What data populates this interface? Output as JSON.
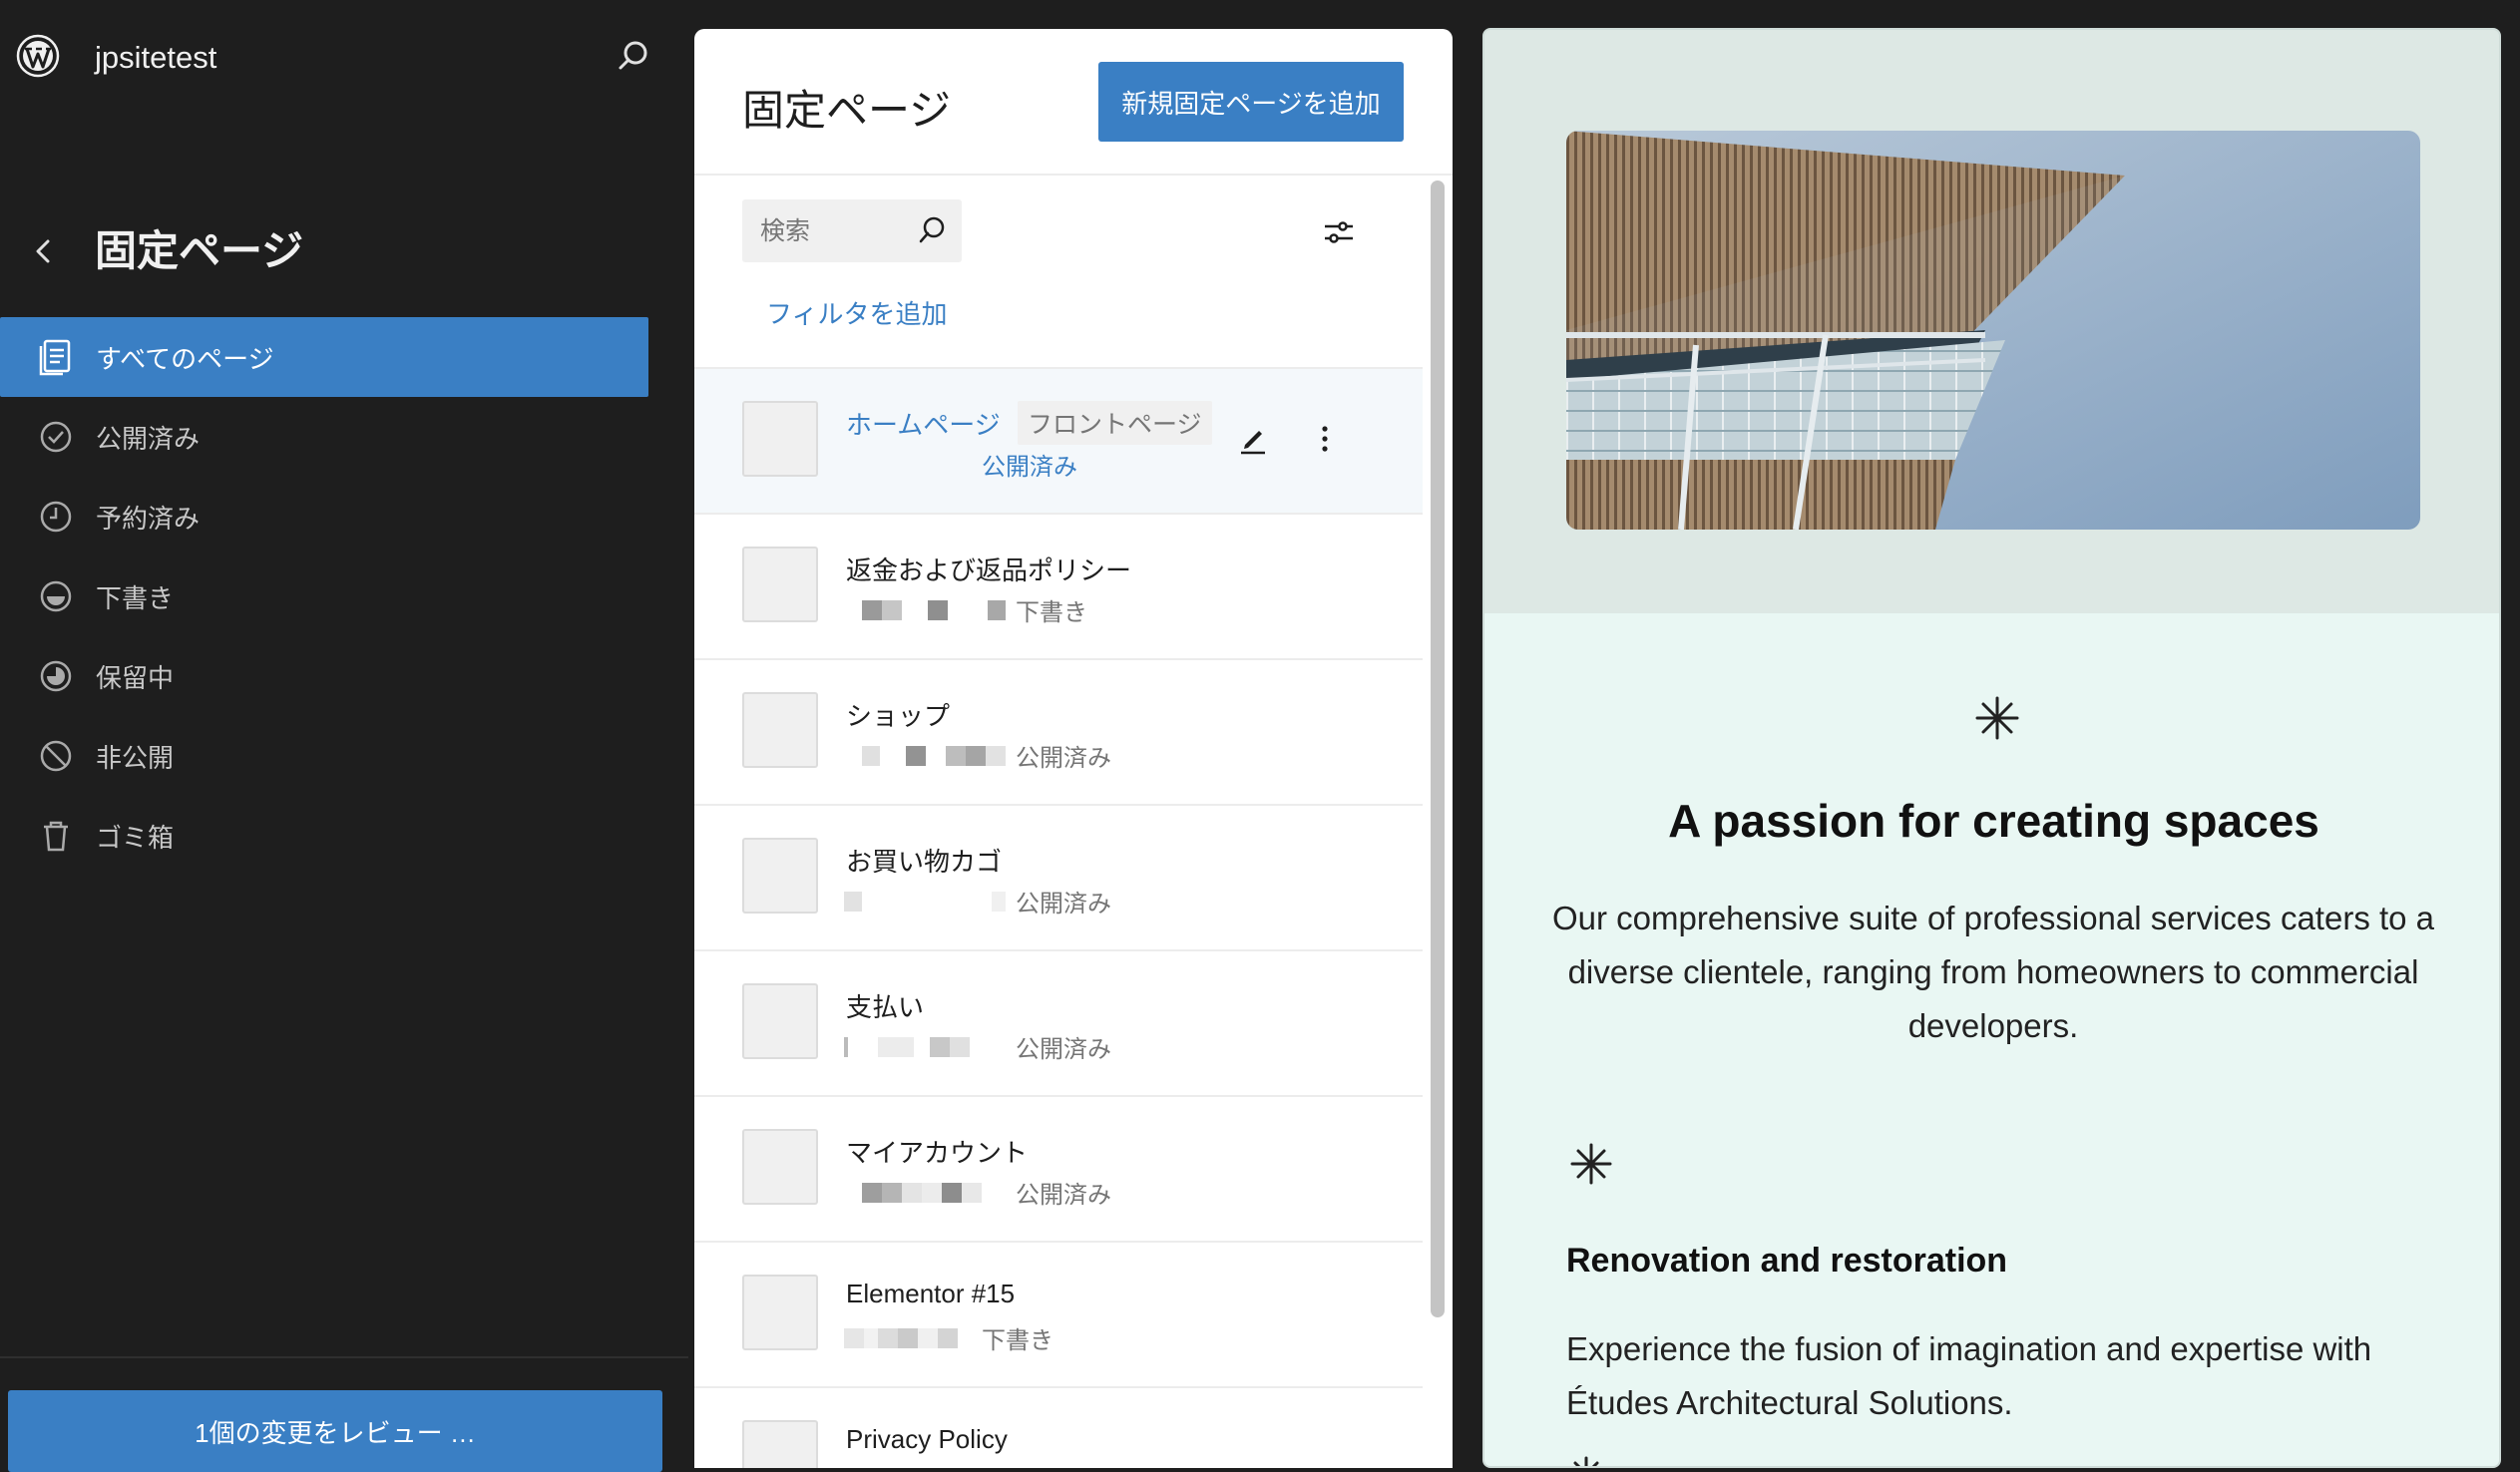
{
  "site": {
    "title": "jpsitetest"
  },
  "sidebar": {
    "heading": "固定ページ",
    "items": [
      {
        "label": "すべてのページ",
        "icon": "pages-icon",
        "active": true
      },
      {
        "label": "公開済み",
        "icon": "published-icon"
      },
      {
        "label": "予約済み",
        "icon": "scheduled-icon"
      },
      {
        "label": "下書き",
        "icon": "drafts-icon"
      },
      {
        "label": "保留中",
        "icon": "pending-icon"
      },
      {
        "label": "非公開",
        "icon": "private-icon"
      },
      {
        "label": "ゴミ箱",
        "icon": "trash-icon"
      }
    ],
    "review_button": "1個の変更をレビュー …"
  },
  "pages_panel": {
    "title": "固定ページ",
    "add_button": "新規固定ページを追加",
    "search_placeholder": "検索",
    "add_filter": "フィルタを追加",
    "rows": [
      {
        "title": "ホームページ",
        "tag": "フロントページ",
        "status": "公開済み"
      },
      {
        "title": "返金および返品ポリシー",
        "status": "下書き"
      },
      {
        "title": "ショップ",
        "status": "公開済み"
      },
      {
        "title": "お買い物カゴ",
        "status": "公開済み"
      },
      {
        "title": "支払い",
        "status": "公開済み"
      },
      {
        "title": "マイアカウント",
        "status": "公開済み"
      },
      {
        "title": "Elementor #15",
        "status": "下書き"
      },
      {
        "title": "Privacy Policy",
        "status": ""
      }
    ]
  },
  "preview": {
    "heading": "A passion for creating spaces",
    "paragraph": "Our comprehensive suite of professional services caters to a diverse clientele, ranging from homeowners to commercial developers.",
    "service_title": "Renovation and restoration",
    "service_text": "Experience the fusion of imagination and expertise with Études Architectural Solutions."
  },
  "colors": {
    "accent": "#3a7fc4",
    "sidebar_bg": "#1e1e1e",
    "preview_bg": "#e9f7f3"
  }
}
